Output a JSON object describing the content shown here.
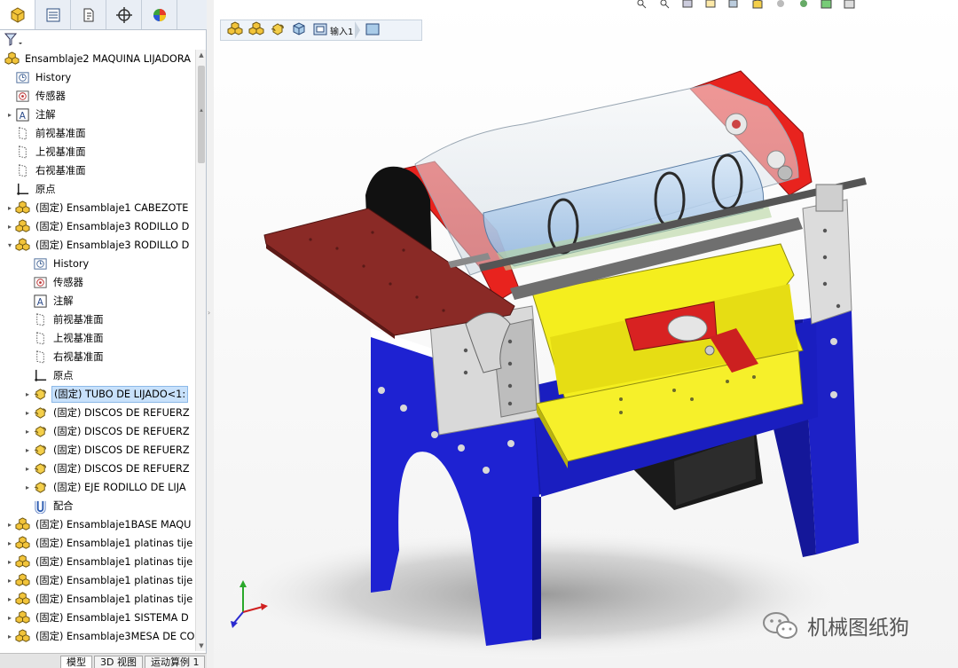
{
  "panel": {
    "tabs": [
      {
        "icon": "feature-manager-icon"
      },
      {
        "icon": "property-manager-icon"
      },
      {
        "icon": "configuration-manager-icon"
      },
      {
        "icon": "dimxpert-manager-icon"
      },
      {
        "icon": "display-manager-icon"
      }
    ],
    "filter_icon": "filter-icon"
  },
  "tree": {
    "items": [
      {
        "label": "Ensamblaje2 MAQUINA LIJADORA",
        "icon": "assembly-icon",
        "arrow": "",
        "indent": 0
      },
      {
        "label": "History",
        "icon": "history-icon",
        "arrow": "",
        "indent": 1
      },
      {
        "label": "传感器",
        "icon": "sensor-icon",
        "arrow": "",
        "indent": 1
      },
      {
        "label": "注解",
        "icon": "annotation-icon",
        "arrow": "▸",
        "indent": 1
      },
      {
        "label": "前视基准面",
        "icon": "plane-icon",
        "arrow": "",
        "indent": 1
      },
      {
        "label": "上视基准面",
        "icon": "plane-icon",
        "arrow": "",
        "indent": 1
      },
      {
        "label": "右视基准面",
        "icon": "plane-icon",
        "arrow": "",
        "indent": 1
      },
      {
        "label": "原点",
        "icon": "origin-icon",
        "arrow": "",
        "indent": 1
      },
      {
        "label": "(固定) Ensamblaje1 CABEZOTE",
        "icon": "assembly-icon",
        "arrow": "▸",
        "indent": 1
      },
      {
        "label": "(固定) Ensamblaje3 RODILLO D",
        "icon": "assembly-icon",
        "arrow": "▸",
        "indent": 1
      },
      {
        "label": "(固定) Ensamblaje3 RODILLO D",
        "icon": "assembly-icon",
        "arrow": "▾",
        "indent": 1
      },
      {
        "label": "History",
        "icon": "history-icon",
        "arrow": "",
        "indent": 2
      },
      {
        "label": "传感器",
        "icon": "sensor-icon",
        "arrow": "",
        "indent": 2
      },
      {
        "label": "注解",
        "icon": "annotation-icon",
        "arrow": "",
        "indent": 2
      },
      {
        "label": "前视基准面",
        "icon": "plane-icon",
        "arrow": "",
        "indent": 2
      },
      {
        "label": "上视基准面",
        "icon": "plane-icon",
        "arrow": "",
        "indent": 2
      },
      {
        "label": "右视基准面",
        "icon": "plane-icon",
        "arrow": "",
        "indent": 2
      },
      {
        "label": "原点",
        "icon": "origin-icon",
        "arrow": "",
        "indent": 2
      },
      {
        "label": "(固定) TUBO DE LIJADO<1:",
        "icon": "part-icon",
        "arrow": "▸",
        "indent": 2,
        "selected": true
      },
      {
        "label": "(固定) DISCOS DE REFUERZ",
        "icon": "part-icon",
        "arrow": "▸",
        "indent": 2
      },
      {
        "label": "(固定) DISCOS DE REFUERZ",
        "icon": "part-icon",
        "arrow": "▸",
        "indent": 2
      },
      {
        "label": "(固定) DISCOS DE REFUERZ",
        "icon": "part-icon",
        "arrow": "▸",
        "indent": 2
      },
      {
        "label": "(固定) DISCOS DE REFUERZ",
        "icon": "part-icon",
        "arrow": "▸",
        "indent": 2
      },
      {
        "label": "(固定) EJE RODILLO DE LIJA",
        "icon": "part-icon",
        "arrow": "▸",
        "indent": 2
      },
      {
        "label": "配合",
        "icon": "mates-icon",
        "arrow": "",
        "indent": 2
      },
      {
        "label": "(固定) Ensamblaje1BASE MAQU",
        "icon": "assembly-icon",
        "arrow": "▸",
        "indent": 1
      },
      {
        "label": "(固定) Ensamblaje1 platinas tije",
        "icon": "assembly-icon",
        "arrow": "▸",
        "indent": 1
      },
      {
        "label": "(固定) Ensamblaje1 platinas tije",
        "icon": "assembly-icon",
        "arrow": "▸",
        "indent": 1
      },
      {
        "label": "(固定) Ensamblaje1 platinas tije",
        "icon": "assembly-icon",
        "arrow": "▸",
        "indent": 1
      },
      {
        "label": "(固定) Ensamblaje1 platinas tije",
        "icon": "assembly-icon",
        "arrow": "▸",
        "indent": 1
      },
      {
        "label": "(固定) Ensamblaje1 SISTEMA D",
        "icon": "assembly-icon",
        "arrow": "▸",
        "indent": 1
      },
      {
        "label": "(固定) Ensamblaje3MESA DE CO",
        "icon": "assembly-icon",
        "arrow": "▸",
        "indent": 1
      }
    ]
  },
  "bottom_tabs": [
    "模型",
    "3D 视图",
    "运动算例 1"
  ],
  "breadcrumb": {
    "items": [
      {
        "icon": "assembly-icon"
      },
      {
        "icon": "assembly-icon"
      },
      {
        "icon": "part-icon"
      },
      {
        "icon": "cube-icon"
      },
      {
        "icon": "sketch-feature-icon",
        "text": "输入1"
      },
      {
        "icon": "face-icon"
      }
    ]
  },
  "watermark": {
    "text": "机械图纸狗",
    "icon": "wechat-icon"
  },
  "colors": {
    "base_blue": "#1e22d2",
    "bed_yellow": "#f4ee1e",
    "head_red": "#e8231e",
    "table_red": "#8a2a26",
    "selection": "#c8e1fb"
  }
}
